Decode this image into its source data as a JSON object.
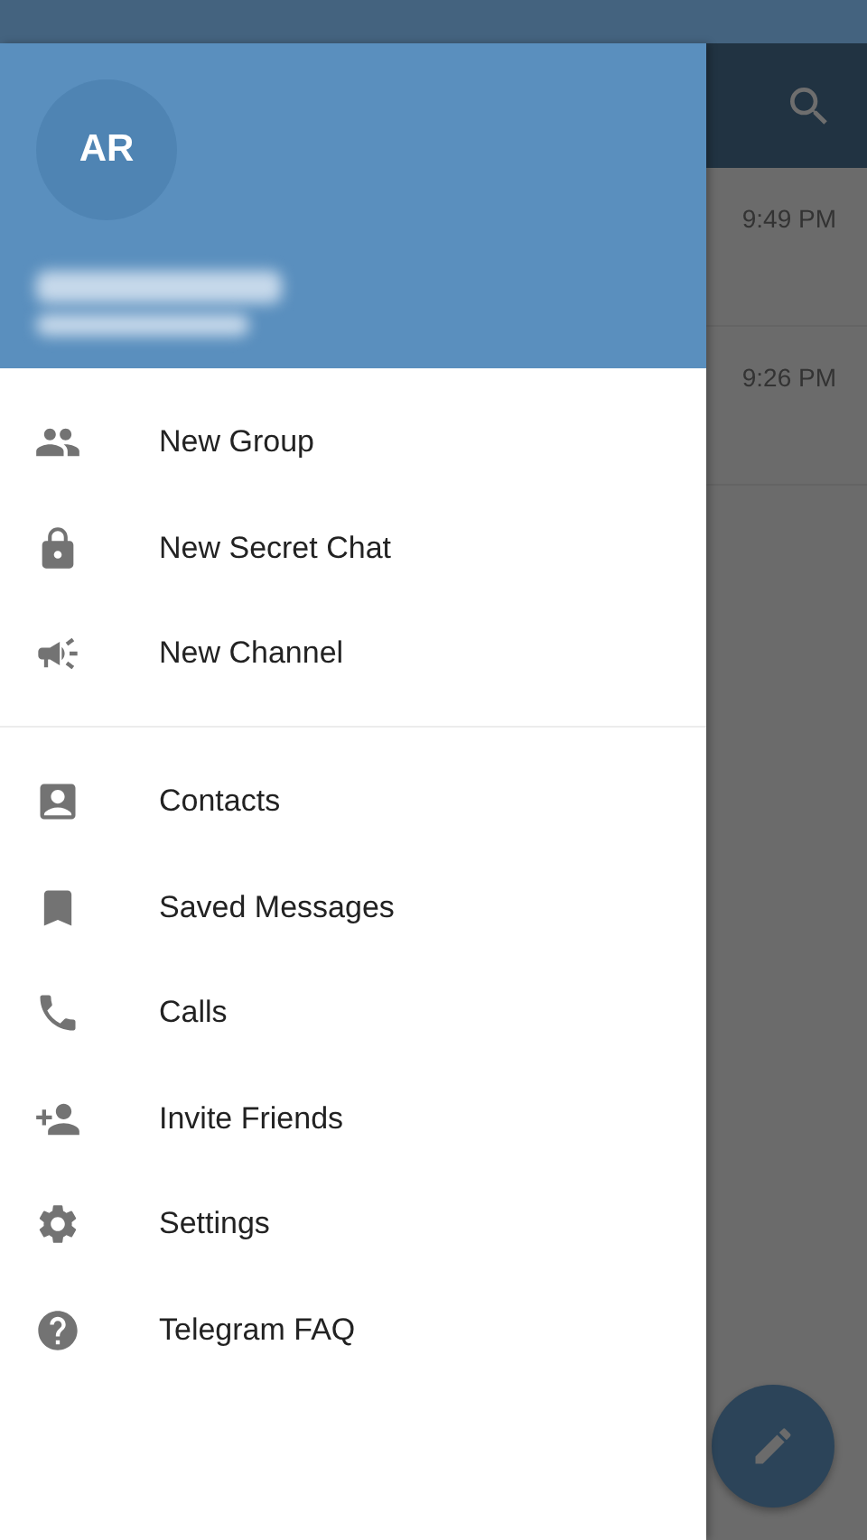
{
  "drawer": {
    "avatar": {
      "initials": "AR"
    },
    "menu_groups": [
      {
        "items": [
          {
            "label": "New Group"
          },
          {
            "label": "New Secret Chat"
          },
          {
            "label": "New Channel"
          }
        ]
      },
      {
        "items": [
          {
            "label": "Contacts"
          },
          {
            "label": "Saved Messages"
          },
          {
            "label": "Calls"
          },
          {
            "label": "Invite Friends"
          },
          {
            "label": "Settings"
          },
          {
            "label": "Telegram FAQ"
          }
        ]
      }
    ]
  },
  "chat_list": {
    "rows": [
      {
        "time": "9:49 PM"
      },
      {
        "time": "9:26 PM"
      }
    ]
  }
}
